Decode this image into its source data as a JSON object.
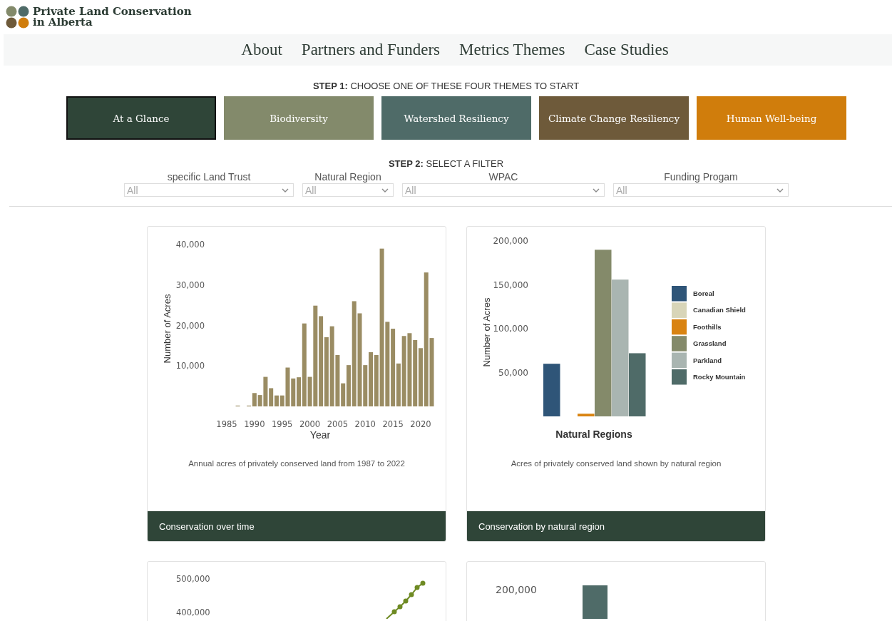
{
  "logo": {
    "lines": [
      "Private Land Conservation",
      "in Alberta"
    ]
  },
  "nav": [
    "About",
    "Partners and Funders",
    "Metrics Themes",
    "Case Studies"
  ],
  "step1": "**STEP 1:** CHOOSE ONE OF THESE FOUR THEMES TO START",
  "themes": [
    {
      "label": "At a Glance",
      "selected": true,
      "color": "#2f4538"
    },
    {
      "label": "Biodiversity",
      "selected": false,
      "color": "#838a6b"
    },
    {
      "label": "Watershed Resiliency",
      "selected": false,
      "color": "#4f6b68"
    },
    {
      "label": "Climate Change Resiliency",
      "selected": false,
      "color": "#6e5a3a"
    },
    {
      "label": "Human Well-being",
      "selected": false,
      "color": "#d07d0c"
    }
  ],
  "step2": "**STEP 2:** SELECT A FILTER",
  "filters": [
    {
      "label": "specific Land Trust",
      "value": "All"
    },
    {
      "label": "Natural Region",
      "value": "All"
    },
    {
      "label": "WPAC",
      "value": "All"
    },
    {
      "label": "Funding Progam",
      "value": "All"
    }
  ],
  "cards": [
    {
      "chart_data": {
        "type": "bar",
        "xlabel": "Year",
        "ylabel": "Number of Acres",
        "x": [
          1987,
          1988,
          1989,
          1990,
          1991,
          1992,
          1993,
          1994,
          1995,
          1996,
          1997,
          1998,
          1999,
          2000,
          2001,
          2002,
          2003,
          2004,
          2005,
          2006,
          2007,
          2008,
          2009,
          2010,
          2011,
          2012,
          2013,
          2014,
          2015,
          2016,
          2017,
          2018,
          2019,
          2020,
          2021,
          2022
        ],
        "xlim": [
          1985,
          2022
        ],
        "ylim": [
          0,
          40000
        ],
        "series": [
          {
            "color": "#9a8c63",
            "values": [
              200,
              null,
              200,
              3300,
              2800,
              7300,
              4500,
              2700,
              2700,
              9600,
              6900,
              7200,
              20500,
              7300,
              24900,
              22300,
              17100,
              19800,
              12700,
              5700,
              10200,
              26000,
              23000,
              10200,
              13400,
              12700,
              39000,
              20900,
              19200,
              10600,
              17400,
              18100,
              16400,
              14400,
              33100,
              16900
            ]
          }
        ],
        "xticks": [
          1985,
          1990,
          1995,
          2000,
          2005,
          2010,
          2015,
          2020
        ],
        "yticks": [
          {
            "value": 10000,
            "label": "10,000"
          },
          {
            "value": 20000,
            "label": "20,000"
          },
          {
            "value": 30000,
            "label": "30,000"
          },
          {
            "value": 40000,
            "label": "40,000"
          }
        ]
      },
      "caption": "Annual acres of privately conserved land from 1987 to 2022",
      "footer": "Conservation over time"
    },
    {
      "chart_data": {
        "type": "bar",
        "xlabel": "Natural Regions",
        "ylabel": "Number of Acres",
        "ylim": [
          0,
          200000
        ],
        "legend": true,
        "series": [
          {
            "name": "Boreal",
            "color": "#2f5578",
            "values": [
              60000
            ]
          },
          {
            "name": "Canadian Shield",
            "color": "#d8d5b8",
            "values": [
              0
            ]
          },
          {
            "name": "Foothills",
            "color": "#d98311",
            "values": [
              3000
            ]
          },
          {
            "name": "Grassland",
            "color": "#848a6a",
            "values": [
              190000
            ]
          },
          {
            "name": "Parkland",
            "color": "#a9b5b1",
            "values": [
              156000
            ]
          },
          {
            "name": "Rocky Mountain",
            "color": "#4f6b68",
            "values": [
              72000
            ]
          }
        ],
        "yticks": [
          {
            "value": 50000,
            "label": "50,000"
          },
          {
            "value": 100000,
            "label": "100,000"
          },
          {
            "value": 150000,
            "label": "150,000"
          },
          {
            "value": 200000,
            "label": "200,000"
          }
        ]
      },
      "caption": "Acres of privately conserved land shown by natural region",
      "footer": "Conservation by natural region"
    }
  ],
  "more_cards": [
    {
      "kind": "line",
      "ticks": [
        "500,000",
        "400,000"
      ]
    },
    {
      "kind": "bar",
      "ticks": [
        "200,000"
      ]
    }
  ]
}
